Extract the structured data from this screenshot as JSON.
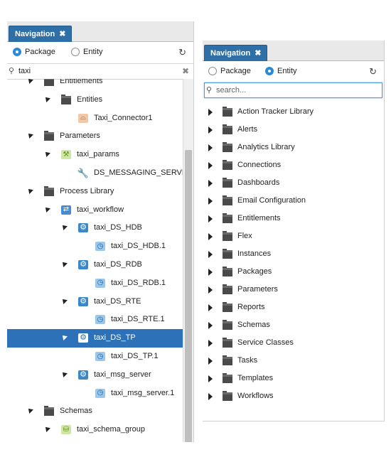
{
  "left": {
    "tab_label": "Navigation",
    "tab_close": "✖",
    "radio_package": "Package",
    "radio_entity": "Entity",
    "selected_radio": "Package",
    "search_value": "taxi",
    "tree": [
      {
        "label": "Entitlements",
        "level": 0,
        "state": "exp",
        "icon": "folder"
      },
      {
        "label": "Entities",
        "level": 1,
        "state": "exp",
        "icon": "folder"
      },
      {
        "label": "Taxi_Connector1",
        "level": 2,
        "state": "leaf",
        "icon": "connector"
      },
      {
        "label": "Parameters",
        "level": 0,
        "state": "exp",
        "icon": "folder"
      },
      {
        "label": "taxi_params",
        "level": 1,
        "state": "exp",
        "icon": "parameter"
      },
      {
        "label": "DS_MESSAGING_SERVER",
        "level": 2,
        "state": "leaf",
        "icon": "parameter-wrench"
      },
      {
        "label": "Process Library",
        "level": 0,
        "state": "exp",
        "icon": "folder"
      },
      {
        "label": "taxi_workflow",
        "level": 1,
        "state": "exp",
        "icon": "workflow"
      },
      {
        "label": "taxi_DS_HDB",
        "level": 2,
        "state": "exp",
        "icon": "gear"
      },
      {
        "label": "taxi_DS_HDB.1",
        "level": 3,
        "state": "leaf",
        "icon": "clock"
      },
      {
        "label": "taxi_DS_RDB",
        "level": 2,
        "state": "exp",
        "icon": "gear"
      },
      {
        "label": "taxi_DS_RDB.1",
        "level": 3,
        "state": "leaf",
        "icon": "clock"
      },
      {
        "label": "taxi_DS_RTE",
        "level": 2,
        "state": "exp",
        "icon": "gear"
      },
      {
        "label": "taxi_DS_RTE.1",
        "level": 3,
        "state": "leaf",
        "icon": "clock"
      },
      {
        "label": "taxi_DS_TP",
        "level": 2,
        "state": "exp",
        "icon": "gear",
        "selected": true
      },
      {
        "label": "taxi_DS_TP.1",
        "level": 3,
        "state": "leaf",
        "icon": "clock"
      },
      {
        "label": "taxi_msg_server",
        "level": 2,
        "state": "exp",
        "icon": "gear"
      },
      {
        "label": "taxi_msg_server.1",
        "level": 3,
        "state": "leaf",
        "icon": "clock"
      },
      {
        "label": "Schemas",
        "level": 0,
        "state": "exp",
        "icon": "folder"
      },
      {
        "label": "taxi_schema_group",
        "level": 1,
        "state": "exp",
        "icon": "database"
      }
    ]
  },
  "right": {
    "tab_label": "Navigation",
    "tab_close": "✖",
    "radio_package": "Package",
    "radio_entity": "Entity",
    "selected_radio": "Entity",
    "search_placeholder": "search...",
    "tree": [
      {
        "label": "Action Tracker Library"
      },
      {
        "label": "Alerts"
      },
      {
        "label": "Analytics Library"
      },
      {
        "label": "Connections"
      },
      {
        "label": "Dashboards"
      },
      {
        "label": "Email Configuration"
      },
      {
        "label": "Entitlements"
      },
      {
        "label": "Flex"
      },
      {
        "label": "Instances"
      },
      {
        "label": "Packages"
      },
      {
        "label": "Parameters"
      },
      {
        "label": "Reports"
      },
      {
        "label": "Schemas"
      },
      {
        "label": "Service Classes"
      },
      {
        "label": "Tasks"
      },
      {
        "label": "Templates"
      },
      {
        "label": "Workflows"
      }
    ]
  },
  "icons": {
    "refresh": "↻",
    "search": "⚲",
    "clear": "✖"
  }
}
